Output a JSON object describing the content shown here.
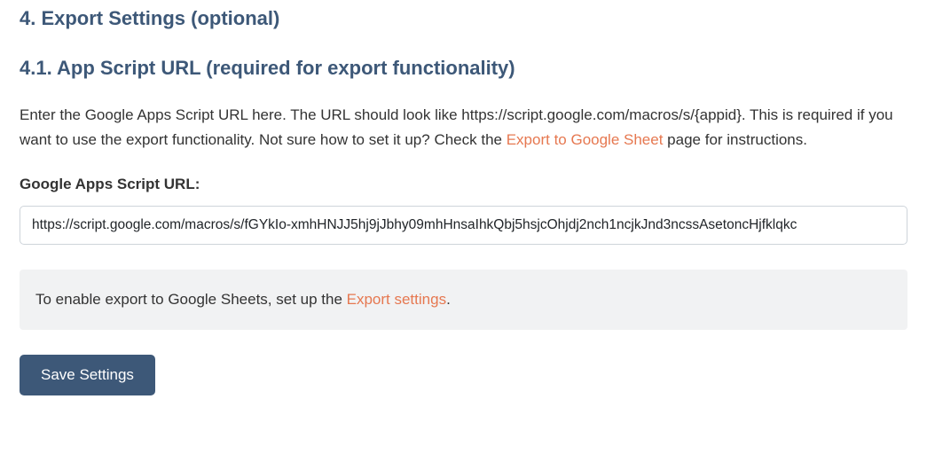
{
  "section": {
    "heading": "4. Export Settings (optional)",
    "subsection_heading": "4.1. App Script URL (required for export functionality)"
  },
  "description": {
    "part1": "Enter the Google Apps Script URL here. The URL should look like https://script.google.com/macros/s/{appid}. This is required if you want to use the export functionality. Not sure how to set it up? Check the ",
    "link_text": "Export to Google Sheet",
    "part2": " page for instructions."
  },
  "field": {
    "label": "Google Apps Script URL:",
    "value": "https://script.google.com/macros/s/fGYkIo-xmhHNJJ5hj9jJbhy09mhHnsaIhkQbj5hsjcOhjdj2nch1ncjkJnd3ncssAsetoncHjfklqkc"
  },
  "notice": {
    "part1": "To enable export to Google Sheets, set up the ",
    "link_text": "Export settings",
    "part2": "."
  },
  "button": {
    "save_label": "Save Settings"
  }
}
